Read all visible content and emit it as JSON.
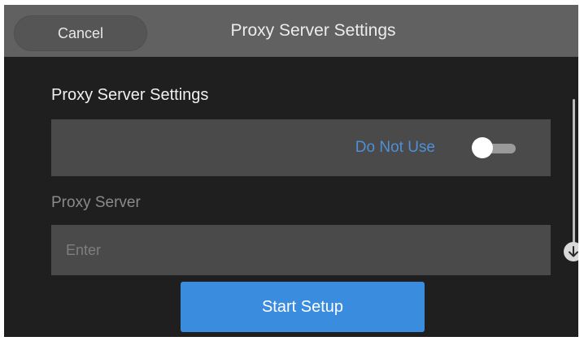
{
  "header": {
    "cancel_label": "Cancel",
    "title": "Proxy Server Settings"
  },
  "section": {
    "title": "Proxy Server Settings"
  },
  "proxy_toggle": {
    "label": "Do Not Use",
    "state": "off",
    "label_color": "#4e8fd6"
  },
  "proxy_server": {
    "label": "Proxy Server",
    "value": "",
    "placeholder": "Enter"
  },
  "scroll": {
    "down_icon": "arrow-down-circle-icon"
  },
  "footer": {
    "start_label": "Start Setup",
    "accent_color": "#3a8cdf"
  }
}
